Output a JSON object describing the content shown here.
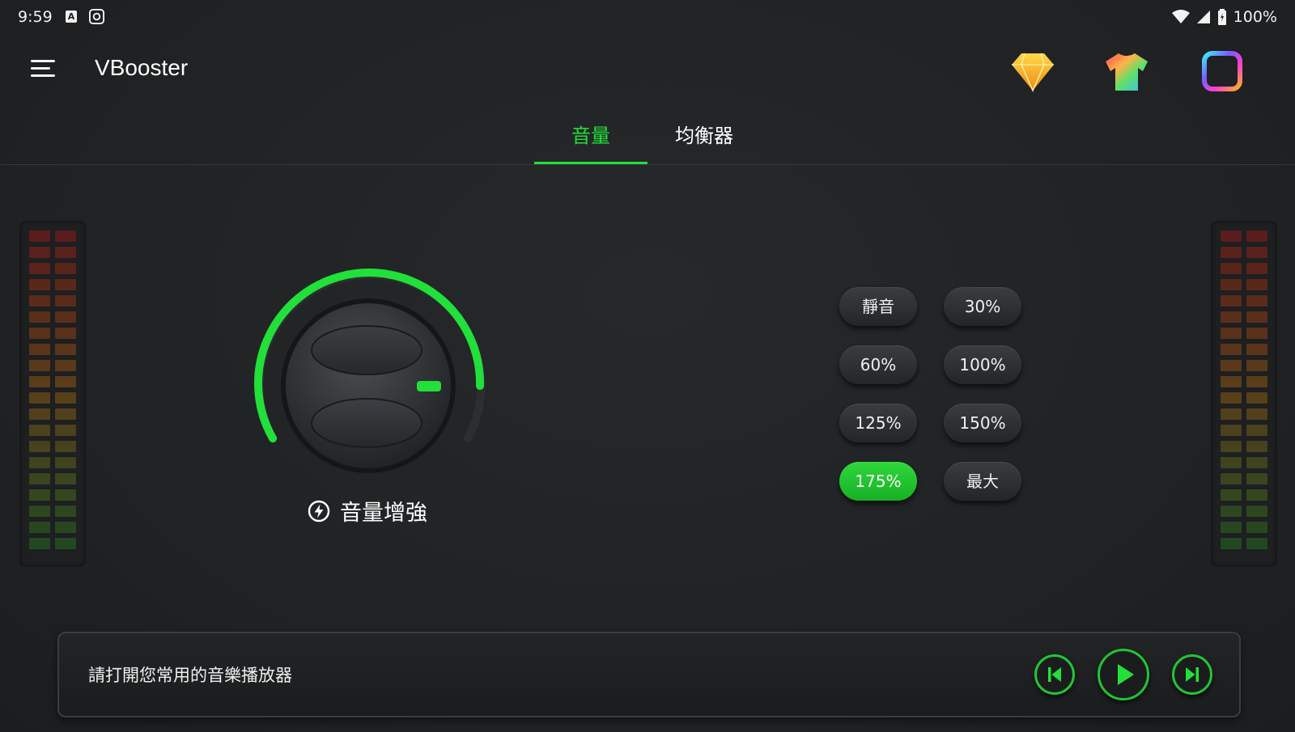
{
  "status_bar": {
    "time": "9:59",
    "a_icon_letter": "A",
    "battery": "100%"
  },
  "app_bar": {
    "title": "VBooster"
  },
  "tabs": [
    {
      "label": "音量",
      "active": true
    },
    {
      "label": "均衡器",
      "active": false
    }
  ],
  "knob": {
    "label": "音量增強",
    "accent_color": "#22e03a"
  },
  "presets": [
    {
      "label": "靜音",
      "active": false
    },
    {
      "label": "30%",
      "active": false
    },
    {
      "label": "60%",
      "active": false
    },
    {
      "label": "100%",
      "active": false
    },
    {
      "label": "125%",
      "active": false
    },
    {
      "label": "150%",
      "active": false
    },
    {
      "label": "175%",
      "active": true
    },
    {
      "label": "最大",
      "active": false
    }
  ],
  "player": {
    "message": "請打開您常用的音樂播放器"
  },
  "icons": {
    "menu": "hamburger-icon",
    "diamond": "diamond-icon",
    "shirt": "shirt-icon",
    "square": "rainbow-square-icon",
    "prev": "skip-previous-icon",
    "play": "play-icon",
    "next": "skip-next-icon"
  }
}
